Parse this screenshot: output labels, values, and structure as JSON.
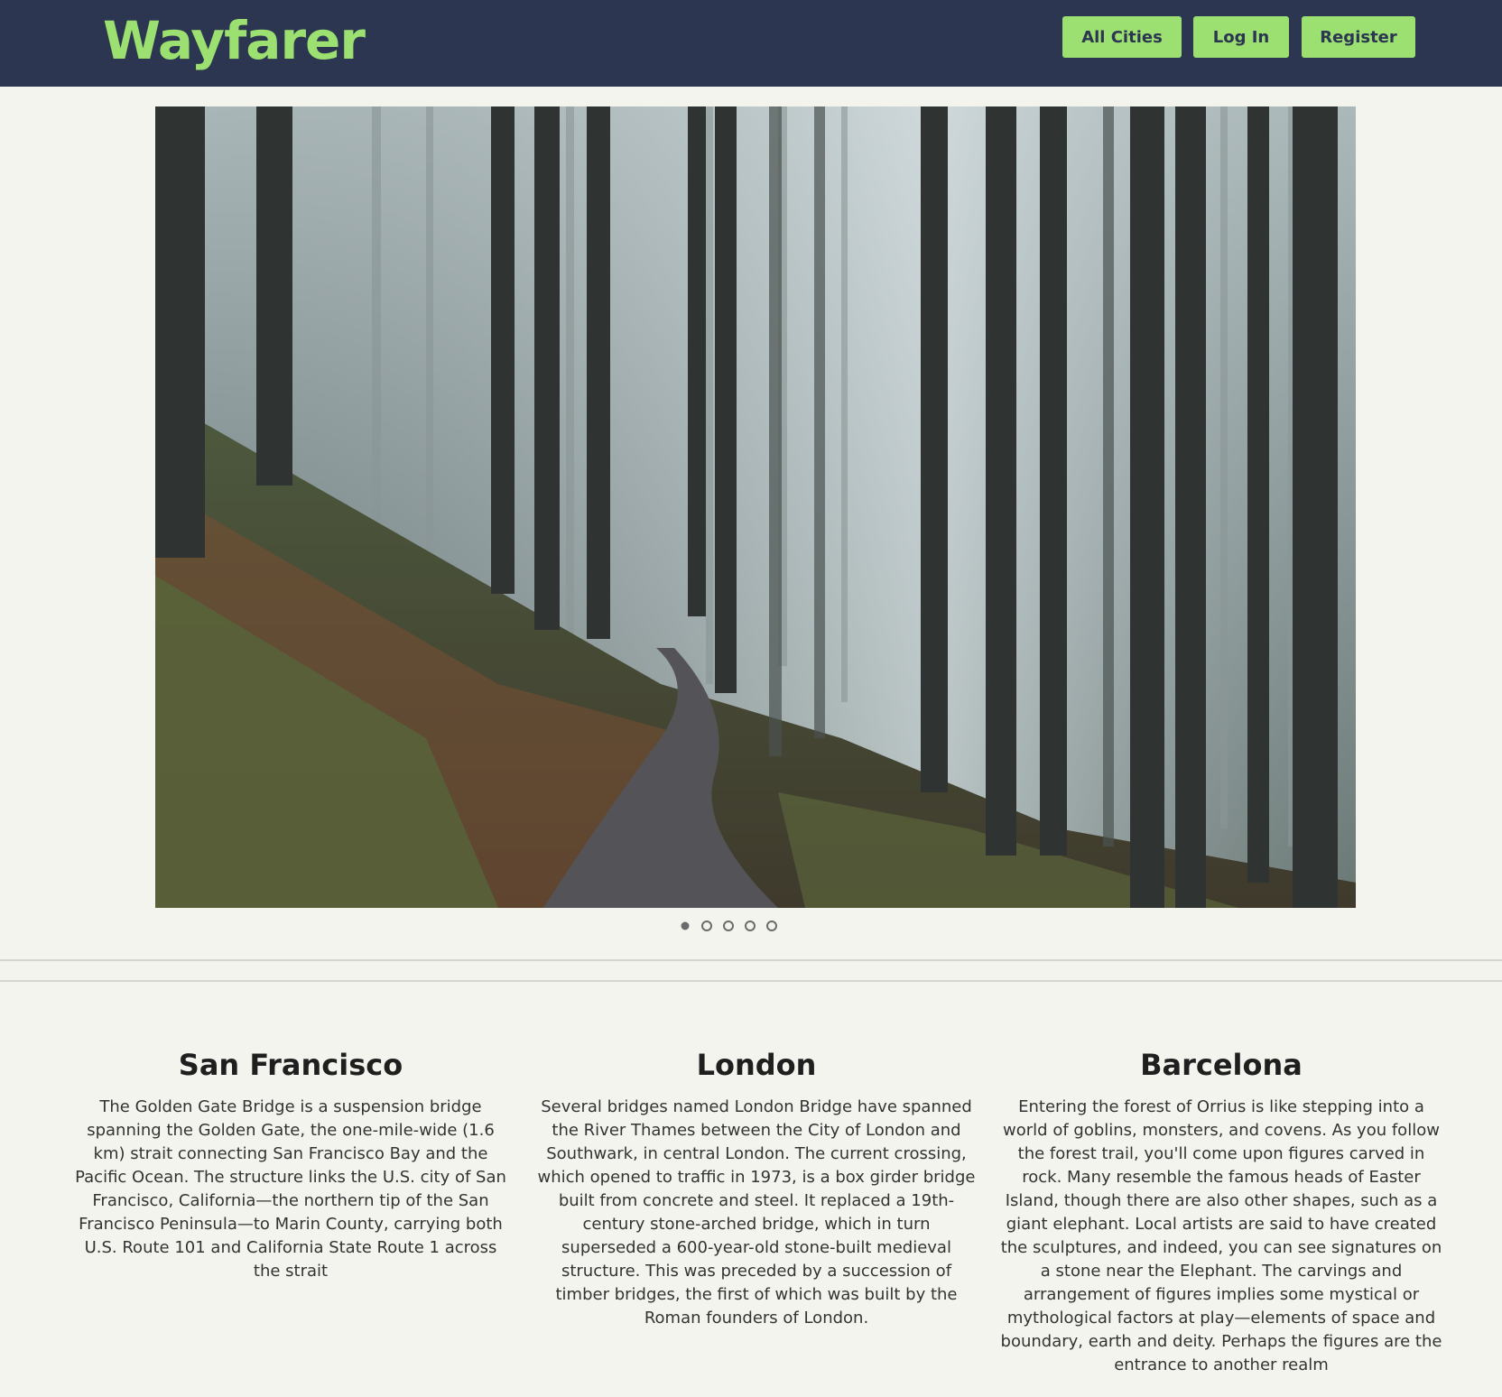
{
  "brand": "Wayfarer",
  "nav": {
    "all_cities": "All Cities",
    "log_in": "Log In",
    "register": "Register"
  },
  "carousel": {
    "slide_count": 5,
    "active_index": 0,
    "image_alt": "misty-forest-trail-photo"
  },
  "cities": [
    {
      "name": "San Francisco",
      "description": "The Golden Gate Bridge is a suspension bridge spanning the Golden Gate, the one-mile-wide (1.6 km) strait connecting San Francisco Bay and the Pacific Ocean. The structure links the U.S. city of San Francisco, California—the northern tip of the San Francisco Peninsula—to Marin County, carrying both U.S. Route 101 and California State Route 1 across the strait"
    },
    {
      "name": "London",
      "description": "Several bridges named London Bridge have spanned the River Thames between the City of London and Southwark, in central London. The current crossing, which opened to traffic in 1973, is a box girder bridge built from concrete and steel. It replaced a 19th-century stone-arched bridge, which in turn superseded a 600-year-old stone-built medieval structure. This was preceded by a succession of timber bridges, the first of which was built by the Roman founders of London."
    },
    {
      "name": "Barcelona",
      "description": "Entering the forest of Orrius is like stepping into a world of goblins, monsters, and covens. As you follow the forest trail, you'll come upon figures carved in rock. Many resemble the famous heads of Easter Island, though there are also other shapes, such as a giant elephant. Local artists are said to have created the sculptures, and indeed, you can see signatures on a stone near the Elephant. The carvings and arrangement of figures implies some mystical or mythological factors at play—elements of space and boundary, earth and deity. Perhaps the figures are the entrance to another realm"
    }
  ],
  "colors": {
    "navbar": "#2c3650",
    "accent": "#9be070",
    "page_bg": "#f4f4ee"
  }
}
